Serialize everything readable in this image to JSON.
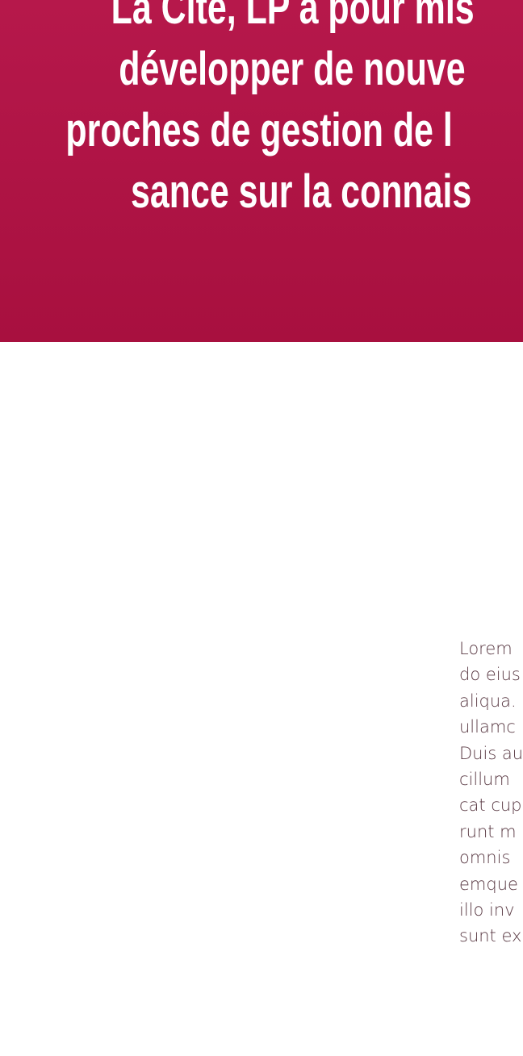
{
  "hero": {
    "title_lines": [
      "La Cité, LP a pour mis",
      "développer de nouve",
      "proches de gestion de l",
      "sance sur la connais"
    ]
  },
  "content": {
    "paragraph_lines": [
      "Lorem",
      "do eius",
      "aliqua.",
      "ullamc",
      "Duis au",
      "cillum",
      "cat cup",
      "runt m",
      "omnis",
      "emque",
      "illo inv",
      "sunt ex"
    ]
  },
  "colors": {
    "hero_gradient_top": "#b6184b",
    "hero_gradient_bottom": "#a8103f",
    "hero_text": "#ffffff",
    "body_text": "#5a3a44",
    "page_background": "#ffffff"
  }
}
